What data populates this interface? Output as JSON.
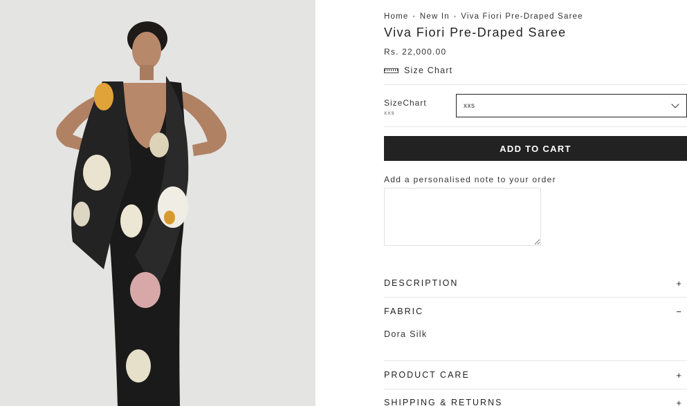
{
  "breadcrumb": {
    "items": [
      "Home",
      "New In",
      "Viva Fiori Pre-Draped Saree"
    ],
    "separator": "•"
  },
  "product": {
    "title": "Viva Fiori Pre-Draped Saree",
    "price": "Rs. 22,000.00",
    "size_chart_link": "Size Chart"
  },
  "size": {
    "label": "SizeChart",
    "selected_sub": "xxs",
    "selected_value": "xxs"
  },
  "cart": {
    "add_label": "ADD TO CART"
  },
  "note": {
    "label": "Add a personalised note to your order",
    "value": ""
  },
  "accordion": {
    "description": {
      "label": "DESCRIPTION",
      "symbol": "+"
    },
    "fabric": {
      "label": "FABRIC",
      "symbol": "−",
      "content": "Dora Silk"
    },
    "product_care": {
      "label": "PRODUCT CARE",
      "symbol": "+"
    },
    "shipping": {
      "label": "SHIPPING & RETURNS",
      "symbol": "+"
    }
  },
  "colors": {
    "button_bg": "#222222",
    "image_bg": "#e4e4e2",
    "saree_base": "#1a1a1a"
  },
  "icons": {
    "ruler": "ruler-icon",
    "chevron": "chevron-down-icon"
  }
}
